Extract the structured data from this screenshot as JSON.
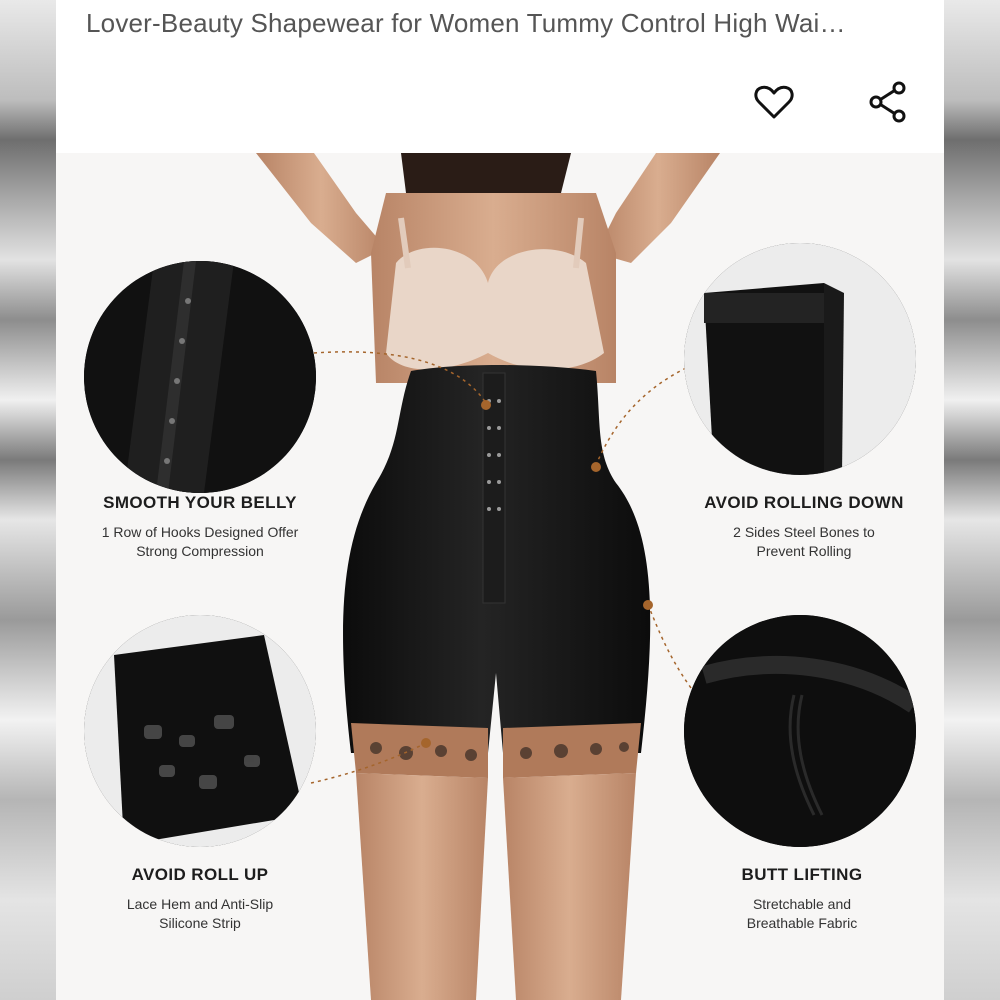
{
  "product": {
    "title": "Lover-Beauty Shapewear for Women Tummy Control High Wai…"
  },
  "actions": {
    "favorite_icon": "heart-outline-icon",
    "share_icon": "share-icon"
  },
  "features": [
    {
      "heading": "SMOOTH YOUR BELLY",
      "line1": "1 Row of Hooks Designed Offer",
      "line2": "Strong Compression"
    },
    {
      "heading": "AVOID ROLLING DOWN",
      "line1": "2 Sides Steel Bones to",
      "line2": "Prevent Rolling"
    },
    {
      "heading": "AVOID ROLL UP",
      "line1": "Lace Hem and Anti-Slip",
      "line2": "Silicone Strip"
    },
    {
      "heading": "BUTT LIFTING",
      "line1": "Stretchable and",
      "line2": "Breathable Fabric"
    }
  ],
  "colors": {
    "garment": "#141414",
    "lace": "#b07a5a",
    "bra": "#e9d6c8",
    "skin": "#c99a7a",
    "callout_dot": "#a5652c"
  }
}
